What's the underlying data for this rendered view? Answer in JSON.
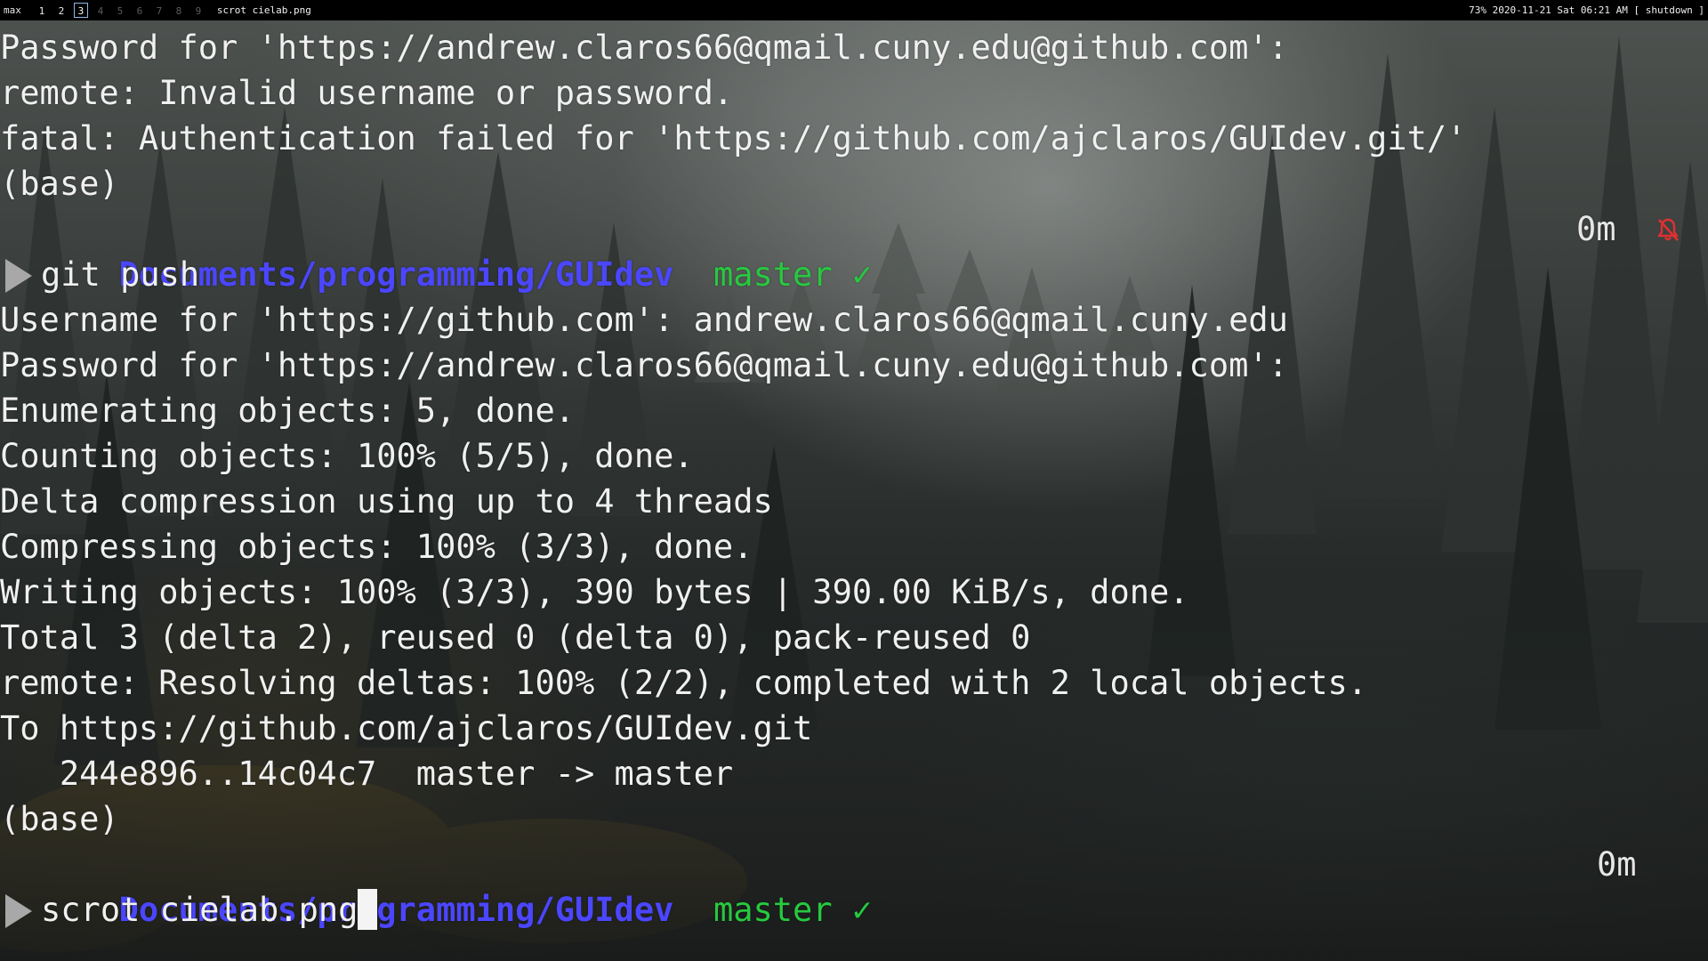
{
  "topbar": {
    "layout": "max",
    "workspaces": [
      {
        "label": "1",
        "state": "occupied"
      },
      {
        "label": "2",
        "state": "occupied"
      },
      {
        "label": "3",
        "state": "active"
      },
      {
        "label": "4",
        "state": "empty"
      },
      {
        "label": "5",
        "state": "empty"
      },
      {
        "label": "6",
        "state": "empty"
      },
      {
        "label": "7",
        "state": "empty"
      },
      {
        "label": "8",
        "state": "empty"
      },
      {
        "label": "9",
        "state": "empty"
      }
    ],
    "window_title": "scrot cielab.png",
    "status": "73% 2020-11-21 Sat 06:21 AM [ shutdown ]"
  },
  "terminal": {
    "lines": [
      {
        "kind": "text",
        "text": "Password for 'https://andrew.claros66@qmail.cuny.edu@github.com':"
      },
      {
        "kind": "text",
        "text": "remote: Invalid username or password."
      },
      {
        "kind": "text",
        "text": "fatal: Authentication failed for 'https://github.com/ajclaros/GUIdev.git/'"
      },
      {
        "kind": "text",
        "text": "(base)"
      },
      {
        "kind": "prompt",
        "path": "Documents/programming/GUIdev",
        "branch": "master",
        "check": "✓",
        "elapsed": "0m",
        "bell_muted": true
      },
      {
        "kind": "command",
        "text": "git push"
      },
      {
        "kind": "text",
        "text": "Username for 'https://github.com': andrew.claros66@qmail.cuny.edu"
      },
      {
        "kind": "text",
        "text": "Password for 'https://andrew.claros66@qmail.cuny.edu@github.com':"
      },
      {
        "kind": "text",
        "text": "Enumerating objects: 5, done."
      },
      {
        "kind": "text",
        "text": "Counting objects: 100% (5/5), done."
      },
      {
        "kind": "text",
        "text": "Delta compression using up to 4 threads"
      },
      {
        "kind": "text",
        "text": "Compressing objects: 100% (3/3), done."
      },
      {
        "kind": "text",
        "text": "Writing objects: 100% (3/3), 390 bytes | 390.00 KiB/s, done."
      },
      {
        "kind": "text",
        "text": "Total 3 (delta 2), reused 0 (delta 0), pack-reused 0"
      },
      {
        "kind": "text",
        "text": "remote: Resolving deltas: 100% (2/2), completed with 2 local objects."
      },
      {
        "kind": "text",
        "text": "To https://github.com/ajclaros/GUIdev.git"
      },
      {
        "kind": "text",
        "text": "   244e896..14c04c7  master -> master"
      },
      {
        "kind": "text",
        "text": "(base)"
      },
      {
        "kind": "prompt",
        "path": "Documents/programming/GUIdev",
        "branch": "master",
        "check": "✓",
        "elapsed": "0m",
        "bell_muted": false
      },
      {
        "kind": "input",
        "text": "scrot cielab.png"
      }
    ]
  },
  "colors": {
    "path": "#4b46ff",
    "branch": "#27c93f",
    "bell": "#e03030",
    "text": "#f0f0f0",
    "prompt_arrow": "#a8a8a8"
  },
  "icons": {
    "prompt": "play-triangle-icon",
    "bell_muted": "bell-off-icon",
    "cursor": "block-cursor"
  }
}
